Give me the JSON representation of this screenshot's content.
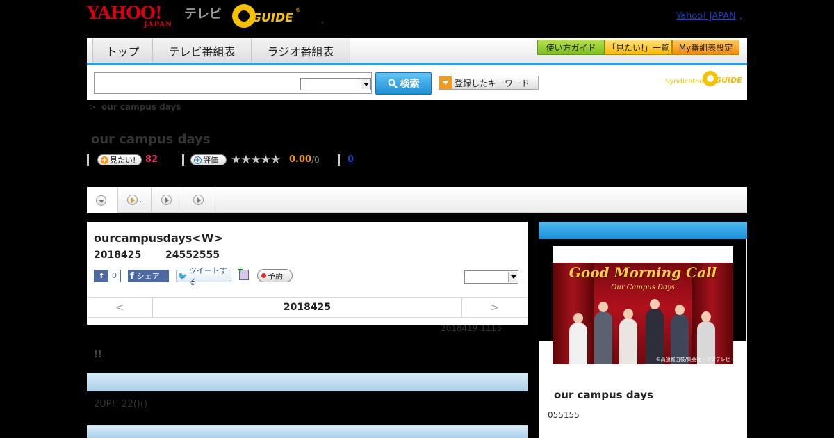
{
  "header": {
    "yahoo_logo": "YAHOO!",
    "yahoo_sub": "JAPAN",
    "tv_label": "テレビ",
    "gguide_logo": "GUIDE",
    "gguide_reg": "®",
    "dot": ",",
    "yahoo_japan_link": "Yahoo! JAPAN",
    "link_sep": ","
  },
  "nav": {
    "tabs": [
      "トップ",
      "テレビ番組表",
      "ラジオ番組表"
    ],
    "buttons": [
      "使い方ガイド",
      "「見たい!」一覧",
      "My番組表設定"
    ]
  },
  "search": {
    "value": "",
    "button_label": "検索",
    "keyword_button": "登録したキーワード",
    "syndicated": "Syndicated",
    "synd_logo": "GUIDE"
  },
  "breadcrumb": {
    "sep": ">",
    "current": "our campus days"
  },
  "program": {
    "title": "our campus days",
    "want_label": "見たい!",
    "want_count": "82",
    "rate_label": "評価",
    "stars": "★★★★★",
    "score": "0.00",
    "score_max": "/0",
    "review_count": "0"
  },
  "tabs": [
    {
      "label": ""
    },
    {
      "label": "."
    },
    {
      "label": ""
    },
    {
      "label": ""
    }
  ],
  "episode": {
    "title": "ourcampusdays<W>",
    "date": "2018425",
    "time": "24552555",
    "fb_like": "f",
    "fb_count": "0",
    "fb_share_icon": "f",
    "fb_share": "シェア",
    "tweet": "ツイートする",
    "reserve": "予約",
    "prev": "<",
    "current_date": "2018425",
    "next": ">",
    "updated": "2018419  1113",
    "exclaim": "!!",
    "description": "2UP!! 22()()"
  },
  "side": {
    "thumb_title": "Good Morning Call",
    "thumb_sub": "Our Campus Days",
    "thumb_caption": "©高須賀由枝/集英社・フジテレビ",
    "title": "our campus days",
    "number": "055155"
  }
}
